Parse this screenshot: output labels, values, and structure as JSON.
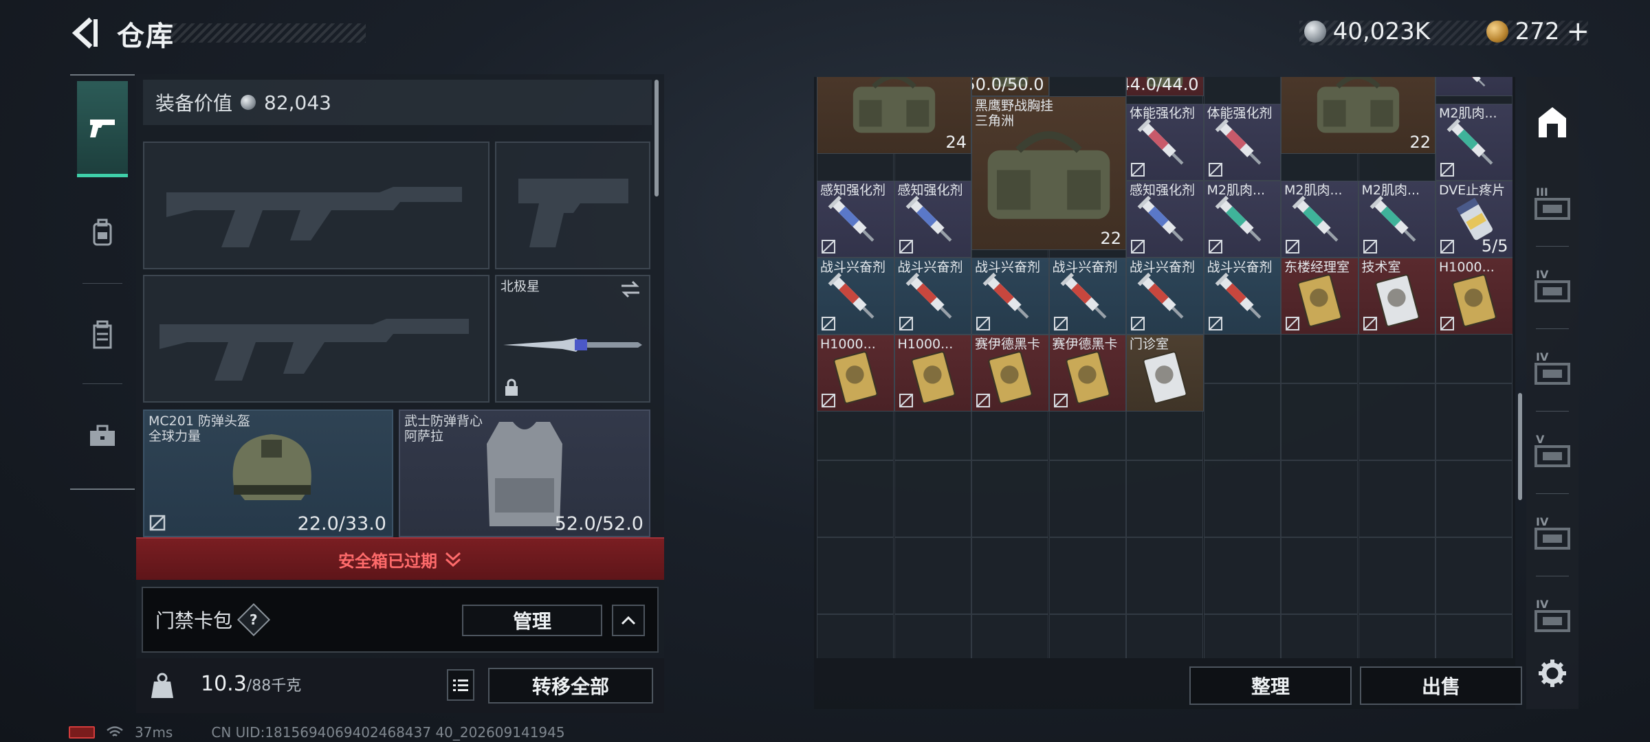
{
  "header": {
    "title": "仓库",
    "currency_coins": "40,023K",
    "currency_gold": "272",
    "add_label": "+"
  },
  "loadout": {
    "equip_value_label": "装备价值",
    "equip_value": "82,043",
    "melee": {
      "name": "北极星"
    },
    "helmet": {
      "name": "MC201 防弹头盔",
      "brand": "全球力量",
      "durability": "22.0/33.0"
    },
    "armor": {
      "name": "武士防弹背心",
      "brand": "阿萨拉",
      "durability": "52.0/52.0"
    },
    "safebox_status": "安全箱已过期",
    "keycard": {
      "label": "门禁卡包",
      "help": "?",
      "manage": "管理"
    },
    "weight_value": "10.3",
    "weight_capacity": "/88千克",
    "transfer_all": "转移全部"
  },
  "storage": {
    "items": [
      {
        "name": "",
        "count": "24",
        "rarity": "brown"
      },
      {
        "name": "",
        "count": "50.0/50.0",
        "rarity": "brown"
      },
      {
        "name": "",
        "count": "44.0/44.0",
        "rarity": "red"
      },
      {
        "name": "",
        "count": "22",
        "rarity": "brown"
      },
      {
        "name": "黑鹰野战胸挂",
        "sub": "三角洲",
        "count": "22",
        "rarity": "brown"
      },
      {
        "name": "体能强化剂",
        "count": "",
        "rarity": "purple"
      },
      {
        "name": "体能强化剂",
        "count": "",
        "rarity": "purple"
      },
      {
        "name": "体能强化剂",
        "count": "",
        "rarity": "purple"
      },
      {
        "name": "感知强化剂",
        "count": "",
        "rarity": "purple"
      },
      {
        "name": "感知强化剂",
        "count": "",
        "rarity": "purple"
      },
      {
        "name": "感知强化剂",
        "count": "",
        "rarity": "purple"
      },
      {
        "name": "M2肌肉...",
        "count": "",
        "rarity": "purple"
      },
      {
        "name": "M2肌肉...",
        "count": "",
        "rarity": "purple"
      },
      {
        "name": "M2肌肉...",
        "count": "",
        "rarity": "purple"
      },
      {
        "name": "M2肌肉...",
        "count": "",
        "rarity": "purple"
      },
      {
        "name": "DVE止疼片",
        "count": "5/5",
        "rarity": "purple"
      },
      {
        "name": "战斗兴奋剂",
        "count": "",
        "rarity": "blue"
      },
      {
        "name": "战斗兴奋剂",
        "count": "",
        "rarity": "blue"
      },
      {
        "name": "战斗兴奋剂",
        "count": "",
        "rarity": "blue"
      },
      {
        "name": "战斗兴奋剂",
        "count": "",
        "rarity": "blue"
      },
      {
        "name": "战斗兴奋剂",
        "count": "",
        "rarity": "blue"
      },
      {
        "name": "战斗兴奋剂",
        "count": "",
        "rarity": "blue"
      },
      {
        "name": "东楼经理室",
        "count": "",
        "rarity": "red"
      },
      {
        "name": "技术室",
        "count": "",
        "rarity": "red"
      },
      {
        "name": "H1000...",
        "count": "",
        "rarity": "red"
      },
      {
        "name": "H1000...",
        "count": "",
        "rarity": "red"
      },
      {
        "name": "H1000...",
        "count": "",
        "rarity": "red"
      },
      {
        "name": "赛伊德黑卡",
        "count": "",
        "rarity": "red"
      },
      {
        "name": "赛伊德黑卡",
        "count": "",
        "rarity": "red"
      },
      {
        "name": "门诊室",
        "count": "",
        "rarity": "gold"
      }
    ],
    "sort_label": "整理",
    "sell_label": "出售"
  },
  "rail": {
    "levels": [
      "III",
      "IV",
      "IV",
      "V",
      "IV",
      "IV"
    ]
  },
  "status": {
    "ping": "37ms",
    "uid": "CN UID:1815694069402468437 40_202609141945"
  },
  "colors": {
    "accent_green": "#3fd0a9",
    "expired_red": "#ff6b6b",
    "rarity_purple": "#3b3c55",
    "rarity_red": "#5a2a2e",
    "rarity_blue": "#2d4558",
    "rarity_brown": "#4e3a2c"
  }
}
